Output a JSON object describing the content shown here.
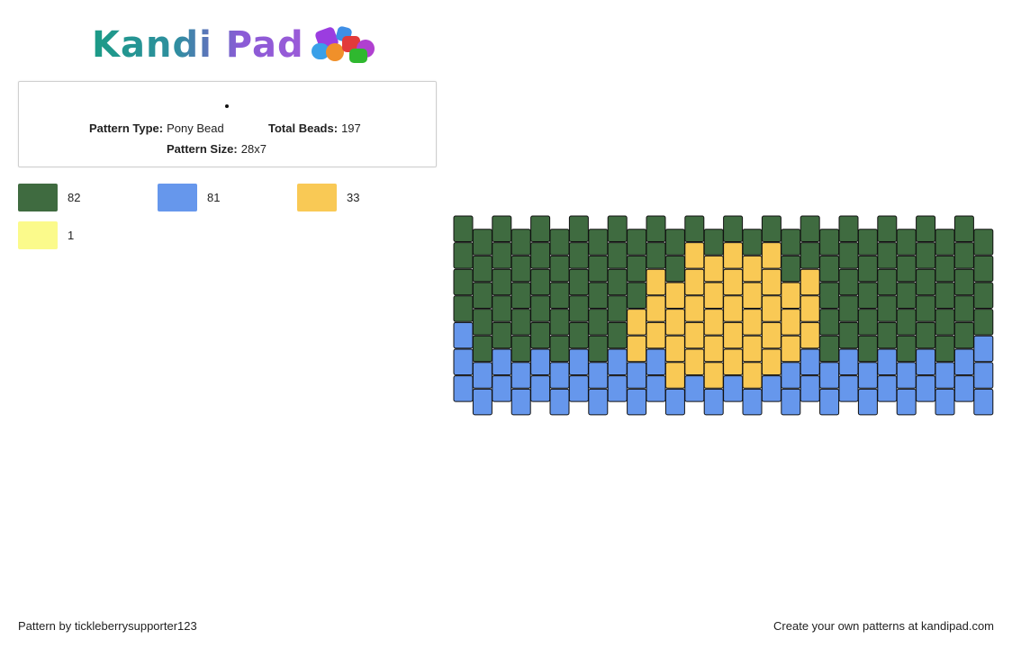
{
  "logo": {
    "text": "Kandi Pad",
    "icon": "bead-pile-icon"
  },
  "info": {
    "pattern_type_label": "Pattern Type:",
    "pattern_type": "Pony Bead",
    "total_beads_label": "Total Beads:",
    "total_beads": "197",
    "pattern_size_label": "Pattern Size:",
    "pattern_size": "28x7"
  },
  "legend": [
    {
      "color": "#3f6b40",
      "count": "82"
    },
    {
      "color": "#6697ec",
      "count": "81"
    },
    {
      "color": "#f9c955",
      "count": "33"
    },
    {
      "color": "#fbfa8b",
      "count": "1"
    }
  ],
  "pattern": {
    "columns": 28,
    "rows": 7,
    "palette": {
      "G": "#3f6b40",
      "B": "#6697ec",
      "Y": "#f9c955"
    },
    "rows_data": [
      "GGGGGGGGGGGGGGGGGGGGGGGGGGGG",
      "GGGGGGGGGGGGYYYYYGGGGGGGGGGG",
      "GGGGGGGGGGYYYYYYYYYGGGGGGGGG",
      "GGGGGGGGGYYYYYYYYYYGGGGGGGGG",
      "BGGGGGGGGYYYYYYYYYYGGGGGGGGB",
      "BBBBBBBBBBBYYYYYYBBBBBBBBBBB",
      "BBBBBBBBBBBBBBBBBBBBBBBBBBBB"
    ]
  },
  "footer": {
    "left": "Pattern by tickleberrysupporter123",
    "right": "Create your own patterns at kandipad.com"
  }
}
